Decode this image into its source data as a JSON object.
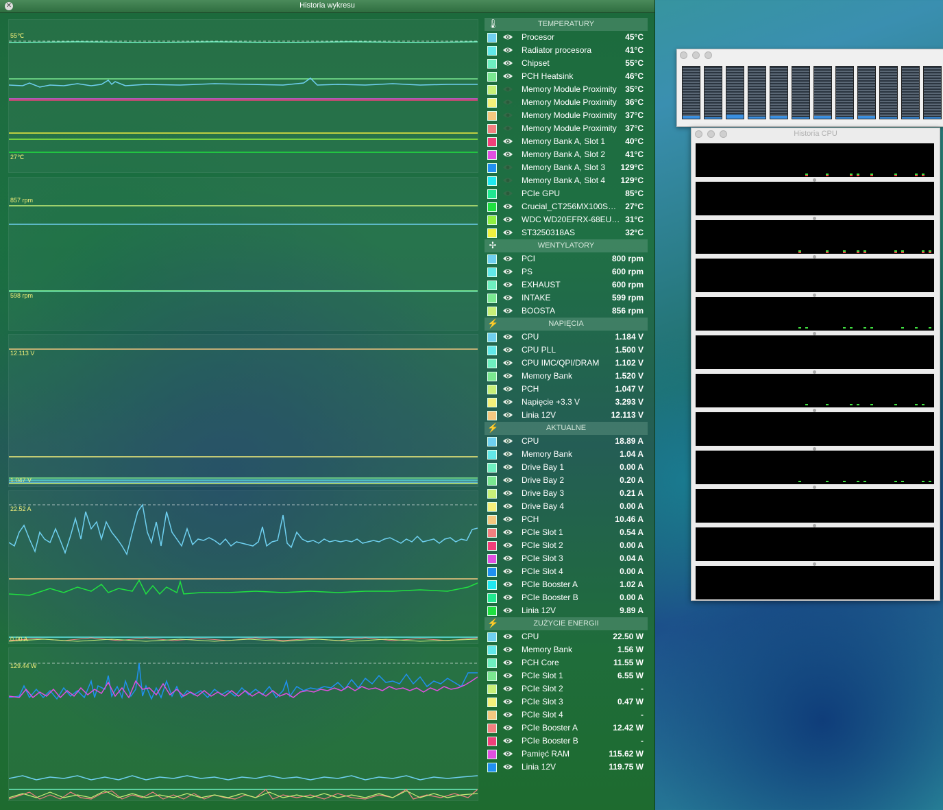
{
  "window": {
    "title": "Historia wykresu"
  },
  "graphs": {
    "temp": {
      "top_label": "55℃",
      "bottom_label": "27℃"
    },
    "fans": {
      "top_label": "857 rpm",
      "bottom_label": "598 rpm"
    },
    "volt": {
      "top_label": "12.113 V",
      "bottom_label": "1.047 V"
    },
    "amps": {
      "top_label": "22.52 A",
      "bottom_label": "0.00 A"
    },
    "power": {
      "top_label": "129.44 W"
    }
  },
  "sections": [
    {
      "title": "TEMPERATURY",
      "icon": "thermometer-icon",
      "glyph": "🌡",
      "rows": [
        {
          "name": "Procesor",
          "value": "45°C",
          "color": "#6fd0f0",
          "visible": true
        },
        {
          "name": "Radiator procesora",
          "value": "41°C",
          "color": "#62e8e8",
          "visible": true
        },
        {
          "name": "Chipset",
          "value": "55°C",
          "color": "#6ef0c0",
          "visible": true
        },
        {
          "name": "PCH Heatsink",
          "value": "46°C",
          "color": "#7ae890",
          "visible": true
        },
        {
          "name": "Memory Module Proximity",
          "value": "35°C",
          "color": "#c8f078",
          "visible": false
        },
        {
          "name": "Memory Module Proximity",
          "value": "36°C",
          "color": "#f5f07a",
          "visible": false
        },
        {
          "name": "Memory Module Proximity",
          "value": "37°C",
          "color": "#f5c880",
          "visible": false
        },
        {
          "name": "Memory Module Proximity",
          "value": "37°C",
          "color": "#f28080",
          "visible": false
        },
        {
          "name": "Memory Bank A, Slot 1",
          "value": "40°C",
          "color": "#f0407a",
          "visible": true
        },
        {
          "name": "Memory Bank A, Slot 2",
          "value": "41°C",
          "color": "#e050e0",
          "visible": true
        },
        {
          "name": "Memory Bank A, Slot 3",
          "value": "129°C",
          "color": "#2090f0",
          "visible": false
        },
        {
          "name": "Memory Bank A, Slot 4",
          "value": "129°C",
          "color": "#20e8f0",
          "visible": false
        },
        {
          "name": "PCIe GPU",
          "value": "85°C",
          "color": "#20e890",
          "visible": false
        },
        {
          "name": "Crucial_CT256MX100SSD1",
          "value": "27°C",
          "color": "#20e040",
          "visible": true
        },
        {
          "name": "WDC WD20EFRX-68EUZN0",
          "value": "31°C",
          "color": "#90f040",
          "visible": true
        },
        {
          "name": "ST3250318AS",
          "value": "32°C",
          "color": "#f0f040",
          "visible": true
        }
      ]
    },
    {
      "title": "WENTYLATORY",
      "icon": "fan-icon",
      "glyph": "✢",
      "rows": [
        {
          "name": "PCI",
          "value": "800 rpm",
          "color": "#6fd0f0",
          "visible": true
        },
        {
          "name": "PS",
          "value": "600 rpm",
          "color": "#62e8e8",
          "visible": true
        },
        {
          "name": "EXHAUST",
          "value": "600 rpm",
          "color": "#6ef0c0",
          "visible": true
        },
        {
          "name": "INTAKE",
          "value": "599 rpm",
          "color": "#7ae890",
          "visible": true
        },
        {
          "name": "BOOSTA",
          "value": "856 rpm",
          "color": "#c8f078",
          "visible": true
        }
      ]
    },
    {
      "title": "NAPIĘCIA",
      "icon": "lightning-icon",
      "glyph": "⚡",
      "rows": [
        {
          "name": "CPU",
          "value": "1.184 V",
          "color": "#6fd0f0",
          "visible": true
        },
        {
          "name": "CPU PLL",
          "value": "1.500 V",
          "color": "#62e8e8",
          "visible": true
        },
        {
          "name": "CPU IMC/QPI/DRAM",
          "value": "1.102 V",
          "color": "#6ef0c0",
          "visible": true
        },
        {
          "name": "Memory Bank",
          "value": "1.520 V",
          "color": "#7ae890",
          "visible": true
        },
        {
          "name": "PCH",
          "value": "1.047 V",
          "color": "#c8f078",
          "visible": true
        },
        {
          "name": "Napięcie +3.3 V",
          "value": "3.293 V",
          "color": "#f5f07a",
          "visible": true
        },
        {
          "name": "Linia 12V",
          "value": "12.113 V",
          "color": "#f5c880",
          "visible": true
        }
      ]
    },
    {
      "title": "AKTUALNE",
      "icon": "lightning-icon",
      "glyph": "⚡",
      "rows": [
        {
          "name": "CPU",
          "value": "18.89 A",
          "color": "#6fd0f0",
          "visible": true
        },
        {
          "name": "Memory Bank",
          "value": "1.04 A",
          "color": "#62e8e8",
          "visible": true
        },
        {
          "name": "Drive Bay 1",
          "value": "0.00 A",
          "color": "#6ef0c0",
          "visible": true
        },
        {
          "name": "Drive Bay 2",
          "value": "0.20 A",
          "color": "#7ae890",
          "visible": true
        },
        {
          "name": "Drive Bay 3",
          "value": "0.21 A",
          "color": "#c8f078",
          "visible": true
        },
        {
          "name": "Drive Bay 4",
          "value": "0.00 A",
          "color": "#f5f07a",
          "visible": true
        },
        {
          "name": "PCH",
          "value": "10.46 A",
          "color": "#f5c880",
          "visible": true
        },
        {
          "name": "PCIe Slot 1",
          "value": "0.54 A",
          "color": "#f28080",
          "visible": true
        },
        {
          "name": "PCIe Slot 2",
          "value": "0.00 A",
          "color": "#f0407a",
          "visible": true
        },
        {
          "name": "PCIe Slot 3",
          "value": "0.04 A",
          "color": "#e050e0",
          "visible": true
        },
        {
          "name": "PCIe Slot 4",
          "value": "0.00 A",
          "color": "#2090f0",
          "visible": true
        },
        {
          "name": "PCIe Booster A",
          "value": "1.02 A",
          "color": "#20e8f0",
          "visible": true
        },
        {
          "name": "PCIe Booster B",
          "value": "0.00 A",
          "color": "#20e890",
          "visible": true
        },
        {
          "name": "Linia 12V",
          "value": "9.89 A",
          "color": "#20e040",
          "visible": true
        }
      ]
    },
    {
      "title": "ZUŻYCIE ENERGII",
      "icon": "lightning-icon",
      "glyph": "⚡",
      "rows": [
        {
          "name": "CPU",
          "value": "22.50 W",
          "color": "#6fd0f0",
          "visible": true
        },
        {
          "name": "Memory Bank",
          "value": "1.56 W",
          "color": "#62e8e8",
          "visible": true
        },
        {
          "name": "PCH Core",
          "value": "11.55 W",
          "color": "#6ef0c0",
          "visible": true
        },
        {
          "name": "PCIe Slot 1",
          "value": "6.55 W",
          "color": "#7ae890",
          "visible": true
        },
        {
          "name": "PCIe Slot 2",
          "value": "-",
          "color": "#c8f078",
          "visible": true
        },
        {
          "name": "PCIe Slot 3",
          "value": "0.47 W",
          "color": "#f5f07a",
          "visible": true
        },
        {
          "name": "PCIe Slot 4",
          "value": "-",
          "color": "#f5c880",
          "visible": true
        },
        {
          "name": "PCIe Booster A",
          "value": "12.42 W",
          "color": "#f28080",
          "visible": true
        },
        {
          "name": "PCIe Booster B",
          "value": "-",
          "color": "#f0407a",
          "visible": true
        },
        {
          "name": "Pamięć RAM",
          "value": "115.62 W",
          "color": "#e050e0",
          "visible": true
        },
        {
          "name": "Linia 12V",
          "value": "119.75 W",
          "color": "#2090f0",
          "visible": true
        }
      ]
    }
  ],
  "cpu_window": {
    "title": "Historia CPU",
    "core_count": 12
  },
  "cpu_bars": {
    "levels": [
      0.05,
      0.03,
      0.08,
      0.04,
      0.05,
      0.03,
      0.05,
      0.03,
      0.05,
      0.03,
      0.03,
      0.03
    ]
  }
}
